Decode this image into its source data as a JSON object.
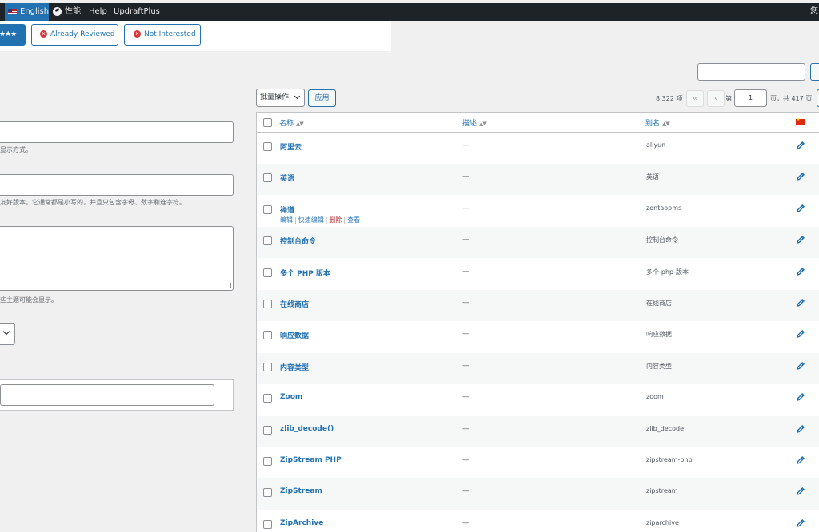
{
  "admin_bar": {
    "language": "English",
    "performance": "性能",
    "help": "Help",
    "updraftplus": "UpdraftPlus",
    "greeting": "您"
  },
  "notice": {
    "rate_label": "★★★",
    "already_reviewed": "Already Reviewed",
    "not_interested": "Not Interested"
  },
  "form": {
    "name_desc": "显示方式。",
    "slug_desc": "友好版本。它通常都是小写的，并且只包含字母、数字和连字符。",
    "description_desc": "些主题可能会显示。"
  },
  "toolbar": {
    "bulk_action": "批量操作",
    "apply": "应用",
    "item_count": "8,322 项",
    "first_page": "«",
    "prev_page": "‹",
    "page_prefix": "第",
    "current_page": "1",
    "page_total": "页，共 417 页"
  },
  "table": {
    "columns": {
      "name": "名称",
      "description": "描述",
      "slug": "别名"
    },
    "row_actions": {
      "edit": "编辑",
      "quick_edit": "快速编辑",
      "delete": "删除",
      "view": "查看",
      "separator": "|"
    },
    "rows": [
      {
        "name": "阿里云",
        "description": "—",
        "slug": "aliyun"
      },
      {
        "name": "英语",
        "description": "—",
        "slug": "英语"
      },
      {
        "name": "禅道",
        "description": "—",
        "slug": "zentaopms"
      },
      {
        "name": "控制台命令",
        "description": "—",
        "slug": "控制台命令"
      },
      {
        "name": "多个 PHP 版本",
        "description": "—",
        "slug": "多个-php-版本"
      },
      {
        "name": "在线商店",
        "description": "—",
        "slug": "在线商店"
      },
      {
        "name": "响应数据",
        "description": "—",
        "slug": "响应数据"
      },
      {
        "name": "内容类型",
        "description": "—",
        "slug": "内容类型"
      },
      {
        "name": "Zoom",
        "description": "—",
        "slug": "zoom"
      },
      {
        "name": "zlib_decode()",
        "description": "—",
        "slug": "zlib_decode"
      },
      {
        "name": "ZipStream PHP",
        "description": "—",
        "slug": "zipstream-php"
      },
      {
        "name": "ZipStream",
        "description": "—",
        "slug": "zipstream"
      },
      {
        "name": "ZipArchive",
        "description": "—",
        "slug": "ziparchive"
      }
    ]
  },
  "colors": {
    "admin_bar": "#1d2327",
    "link": "#2271b1",
    "delete": "#b32d2e",
    "alt_row": "#f6f7f7"
  }
}
